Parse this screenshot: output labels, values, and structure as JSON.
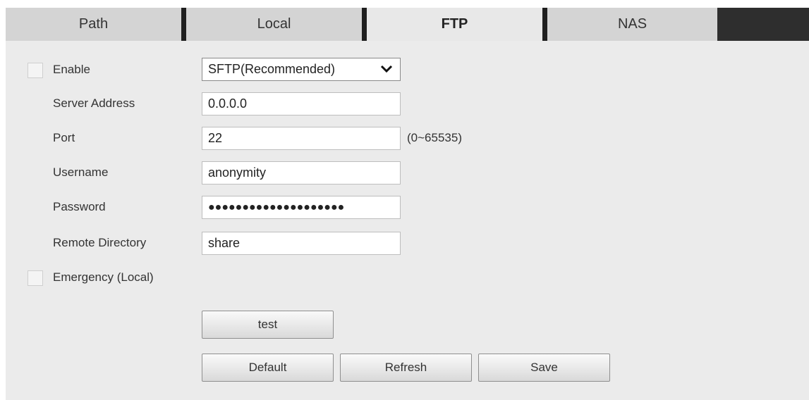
{
  "tabs": [
    {
      "label": "Path",
      "active": false
    },
    {
      "label": "Local",
      "active": false
    },
    {
      "label": "FTP",
      "active": true
    },
    {
      "label": "NAS",
      "active": false
    }
  ],
  "form": {
    "enable": {
      "label": "Enable",
      "checked": false
    },
    "protocol": {
      "selected": "SFTP(Recommended)"
    },
    "server_address": {
      "label": "Server Address",
      "value": "0.0.0.0"
    },
    "port": {
      "label": "Port",
      "value": "22",
      "range_hint": "(0~65535)"
    },
    "username": {
      "label": "Username",
      "value": "anonymity"
    },
    "password": {
      "label": "Password",
      "value": "●●●●●●●●●●●●●●●●●●●●"
    },
    "remote_directory": {
      "label": "Remote Directory",
      "value": "share"
    },
    "emergency": {
      "label": "Emergency (Local)",
      "checked": false
    }
  },
  "buttons": {
    "test": "test",
    "default": "Default",
    "refresh": "Refresh",
    "save": "Save"
  },
  "colors": {
    "tab_inactive": "#d4d4d4",
    "tab_active": "#e8e8e8",
    "panel_bg": "#ebebeb",
    "separator": "#1f1f1f"
  }
}
